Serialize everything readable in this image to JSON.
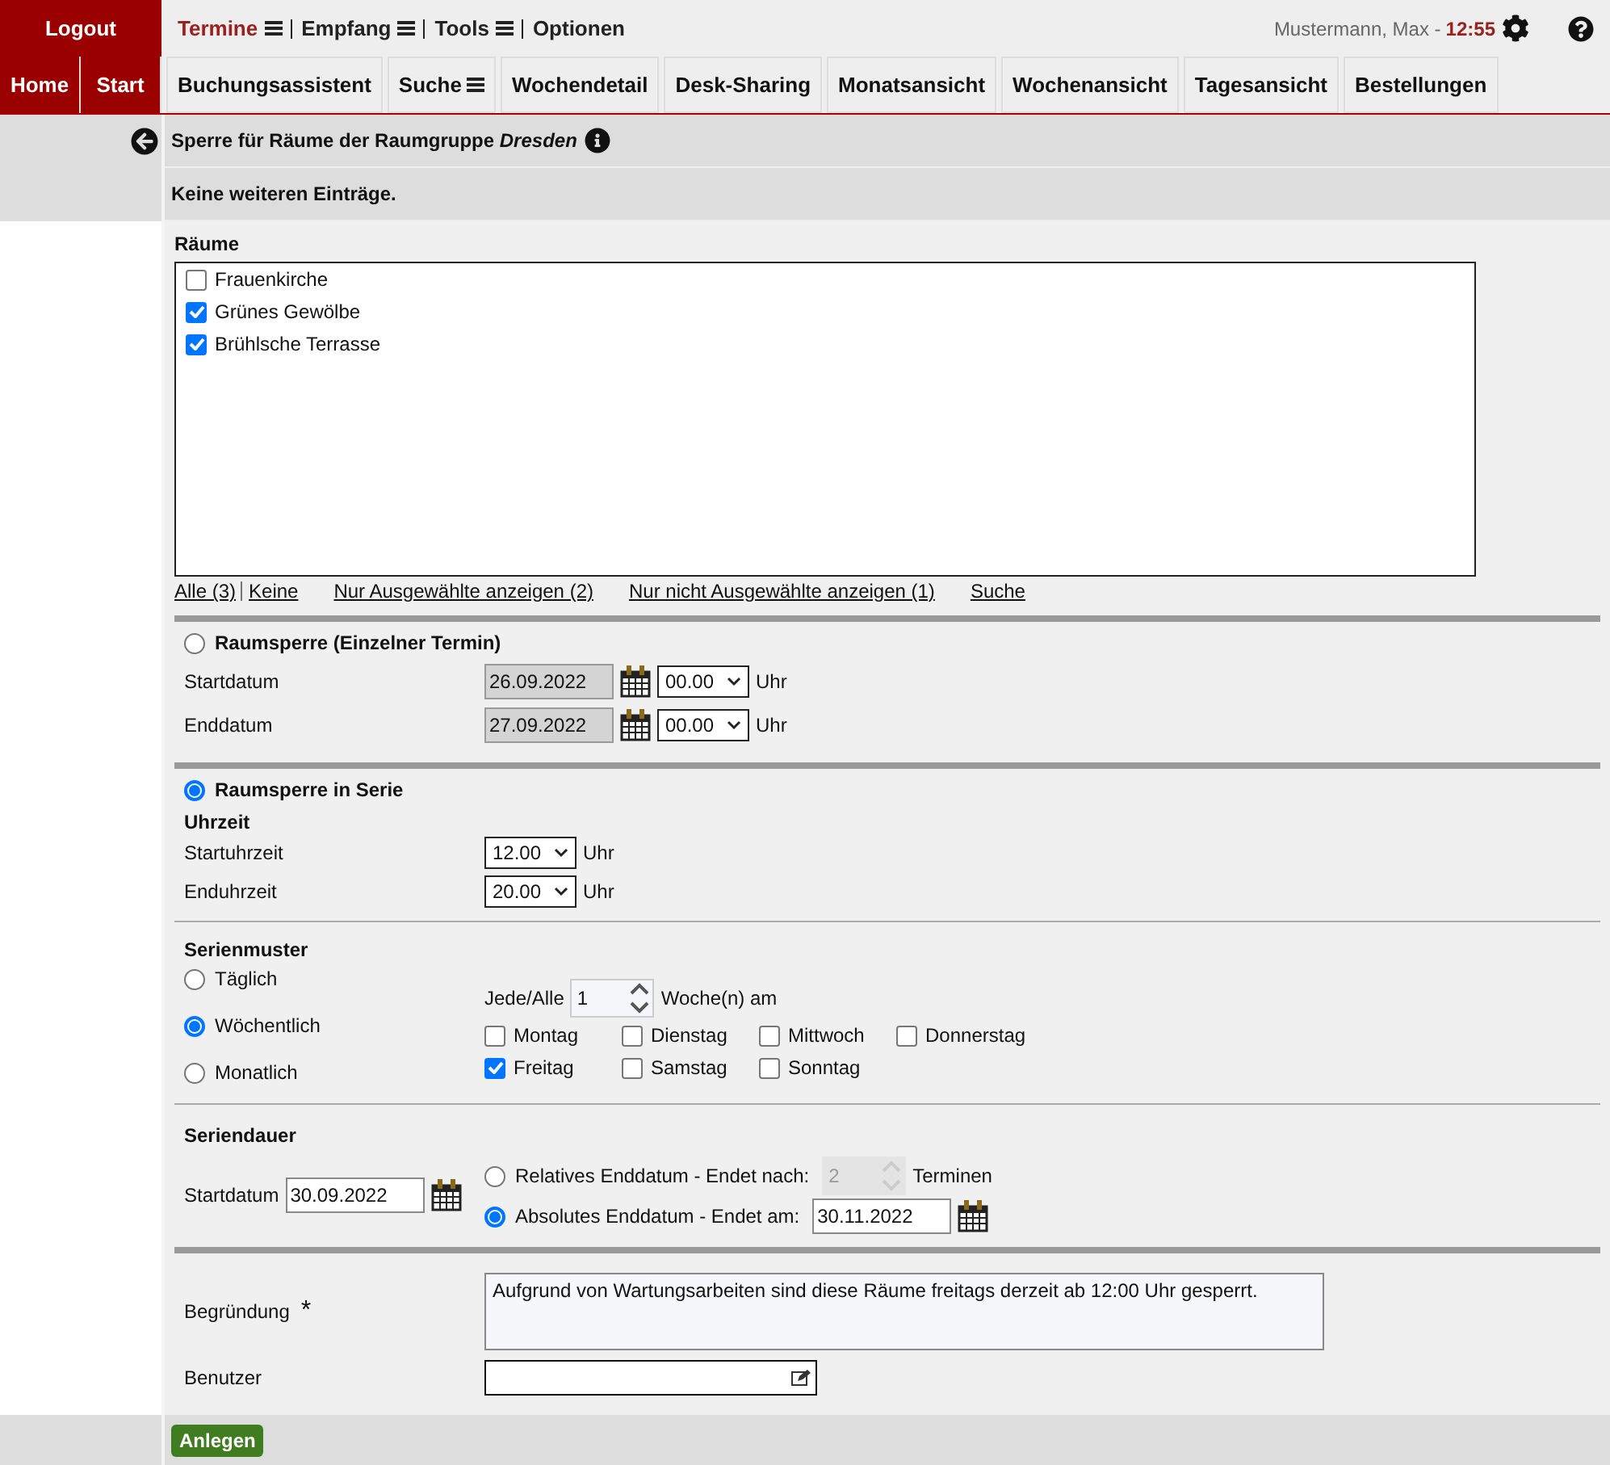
{
  "top_bar": {
    "logout": "Logout",
    "menus": [
      {
        "label": "Termine",
        "selected": true,
        "has_menu": true
      },
      {
        "label": "Empfang",
        "selected": false,
        "has_menu": true
      },
      {
        "label": "Tools",
        "selected": false,
        "has_menu": true
      },
      {
        "label": "Optionen",
        "selected": false,
        "has_menu": false
      }
    ],
    "user": "Mustermann, Max -",
    "time": "12:55"
  },
  "nav": {
    "home": "Home",
    "start": "Start",
    "tabs": [
      {
        "label": "Buchungsassistent",
        "has_menu": false
      },
      {
        "label": "Suche",
        "has_menu": true
      },
      {
        "label": "Wochendetail",
        "has_menu": false
      },
      {
        "label": "Desk-Sharing",
        "has_menu": false
      },
      {
        "label": "Monatsansicht",
        "has_menu": false
      },
      {
        "label": "Wochenansicht",
        "has_menu": false
      },
      {
        "label": "Tagesansicht",
        "has_menu": false
      },
      {
        "label": "Bestellungen",
        "has_menu": false
      }
    ]
  },
  "title": "Sperre für Räume der Raumgruppe *Dresden*",
  "message": "Keine weiteren Einträge.",
  "rooms": {
    "label": "Räume",
    "items": [
      {
        "name": "Frauenkirche",
        "checked": false
      },
      {
        "name": "Grünes Gewölbe",
        "checked": true
      },
      {
        "name": "Brühlsche Terrasse",
        "checked": true
      }
    ],
    "links": [
      {
        "label": "Alle (3)"
      },
      {
        "label": "Keine"
      },
      {
        "label": "Nur Ausgewählte anzeigen (2)"
      },
      {
        "label": "Nur nicht Ausgewählte anzeigen (1)"
      },
      {
        "label": "Suche"
      }
    ]
  },
  "single": {
    "selected": false,
    "title": "Raumsperre (Einzelner Termin)",
    "rows": [
      {
        "label": "Startdatum",
        "date": "26.09.2022",
        "time": "00.00",
        "unit": "Uhr"
      },
      {
        "label": "Enddatum",
        "date": "27.09.2022",
        "time": "00.00",
        "unit": "Uhr"
      }
    ]
  },
  "series": {
    "selected": true,
    "title": "Raumsperre in Serie",
    "time_heading": "Uhrzeit",
    "rows": [
      {
        "label": "Startuhrzeit",
        "time": "12.00",
        "unit": "Uhr"
      },
      {
        "label": "Enduhrzeit",
        "time": "20.00",
        "unit": "Uhr"
      }
    ]
  },
  "pattern": {
    "heading": "Serienmuster",
    "options": [
      {
        "label": "Täglich",
        "selected": false
      },
      {
        "label": "Wöchentlich",
        "selected": true
      },
      {
        "label": "Monatlich",
        "selected": false
      }
    ],
    "every_label": "Jede/Alle",
    "interval": "1",
    "interval_unit": "Woche(n) am",
    "days": [
      {
        "label": "Montag",
        "checked": false
      },
      {
        "label": "Dienstag",
        "checked": false
      },
      {
        "label": "Mittwoch",
        "checked": false
      },
      {
        "label": "Donnerstag",
        "checked": false
      },
      {
        "label": "Freitag",
        "checked": true
      },
      {
        "label": "Samstag",
        "checked": false
      },
      {
        "label": "Sonntag",
        "checked": false
      }
    ]
  },
  "duration": {
    "heading": "Seriendauer",
    "start_label": "Startdatum",
    "start_date": "30.09.2022",
    "end_options": [
      {
        "kind": "relative",
        "label": "Relatives Enddatum - Endet nach:",
        "selected": false,
        "disabled": true,
        "value": "2",
        "unit": "Terminen"
      },
      {
        "kind": "absolute",
        "label": "Absolutes Enddatum - Endet am:",
        "selected": true,
        "disabled": false,
        "value": "30.11.2022"
      }
    ]
  },
  "reason": {
    "label": "Begründung",
    "required": "*",
    "value": "Aufgrund von Wartungsarbeiten sind diese Räume freitags derzeit ab 12:00 Uhr gesperrt."
  },
  "user_field": {
    "label": "Benutzer"
  },
  "submit": "Anlegen"
}
